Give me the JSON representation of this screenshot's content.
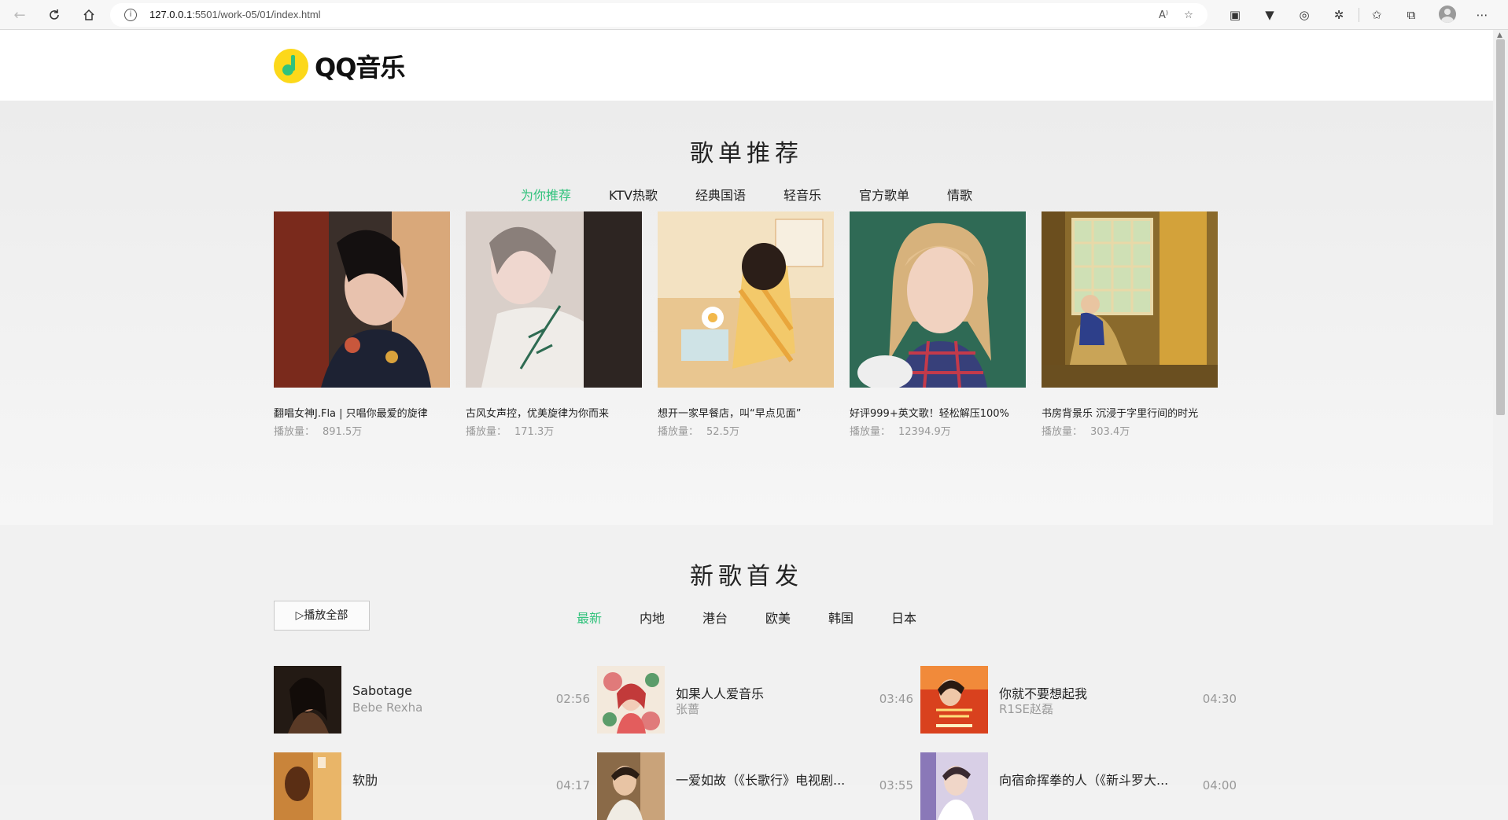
{
  "browser": {
    "url_host": "127.0.0.1",
    "url_path": ":5501/work-05/01/index.html",
    "read_aloud_label": "A⁾"
  },
  "header": {
    "logo_text": "QQ音乐"
  },
  "playlist": {
    "title": "歌单推荐",
    "tabs": [
      "为你推荐",
      "KTV热歌",
      "经典国语",
      "轻音乐",
      "官方歌单",
      "情歌"
    ],
    "plays_label": "播放量：",
    "cards": [
      {
        "title": "翻唱女神J.Fla | 只唱你最爱的旋律",
        "plays": "891.5万"
      },
      {
        "title": "古风女声控，优美旋律为你而来",
        "plays": "171.3万"
      },
      {
        "title": "想开一家早餐店，叫“早点见面”",
        "plays": "52.5万"
      },
      {
        "title": "好评999+英文歌！轻松解压100%",
        "plays": "12394.9万"
      },
      {
        "title": "书房背景乐 沉浸于字里行间的时光",
        "plays": "303.4万"
      }
    ]
  },
  "newsongs": {
    "title": "新歌首发",
    "play_all": "▷播放全部",
    "tabs": [
      "最新",
      "内地",
      "港台",
      "欧美",
      "韩国",
      "日本"
    ],
    "songs": [
      {
        "name": "Sabotage",
        "artist": "Bebe Rexha",
        "duration": "02:56"
      },
      {
        "name": "如果人人爱音乐",
        "artist": "张蔷",
        "duration": "03:46"
      },
      {
        "name": "你就不要想起我",
        "artist": "R1SE赵磊",
        "duration": "04:30"
      },
      {
        "name": "软肋",
        "artist": "",
        "duration": "04:17"
      },
      {
        "name": "一爱如故（《长歌行》电视剧...",
        "artist": "",
        "duration": "03:55"
      },
      {
        "name": "向宿命挥拳的人（《新斗罗大...",
        "artist": "",
        "duration": "04:00"
      }
    ]
  },
  "colors": {
    "accent": "#31c27c",
    "logo_yellow": "#fcd81a"
  }
}
